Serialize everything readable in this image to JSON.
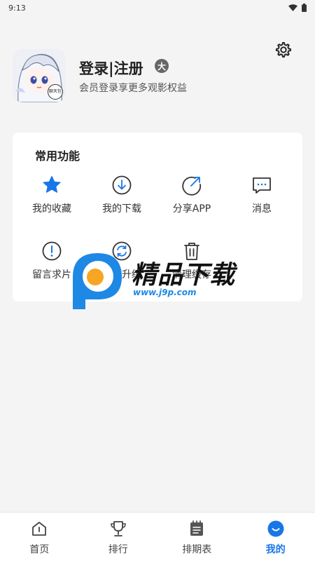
{
  "status_bar": {
    "time": "9:13"
  },
  "profile": {
    "title": "登录|注册",
    "rank_badge": "大",
    "subtitle": "会员登录享更多观影权益",
    "avatar_badge": "聊天包"
  },
  "common_functions": {
    "title": "常用功能",
    "items": [
      {
        "label": "我的收藏",
        "icon": "star-icon"
      },
      {
        "label": "我的下载",
        "icon": "download-icon"
      },
      {
        "label": "分享APP",
        "icon": "share-icon"
      },
      {
        "label": "消息",
        "icon": "message-icon"
      },
      {
        "label": "留言求片",
        "icon": "alert-icon"
      },
      {
        "label": "检查升级",
        "icon": "refresh-icon"
      },
      {
        "label": "清理缓存",
        "icon": "trash-icon"
      }
    ]
  },
  "watermark": {
    "text": "精品下载",
    "url": "www.j9p.com"
  },
  "bottom_nav": {
    "items": [
      {
        "label": "首页",
        "icon": "home-icon",
        "active": false
      },
      {
        "label": "排行",
        "icon": "trophy-icon",
        "active": false
      },
      {
        "label": "排期表",
        "icon": "schedule-icon",
        "active": false
      },
      {
        "label": "我的",
        "icon": "profile-icon",
        "active": true
      }
    ]
  },
  "colors": {
    "accent": "#1976e8",
    "background": "#f4f4f5"
  }
}
